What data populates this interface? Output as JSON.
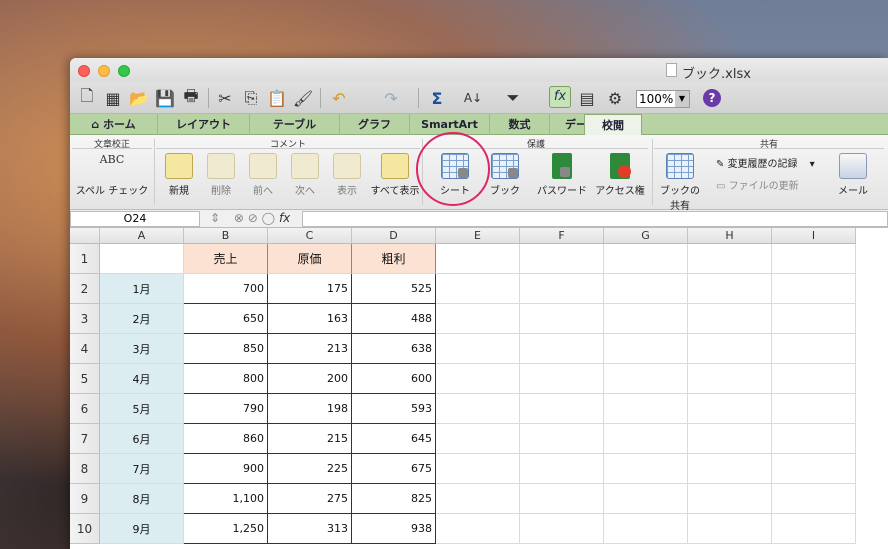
{
  "window": {
    "title": "ブック.xlsx"
  },
  "toolbar": {
    "zoom": "100%",
    "icons": [
      "new-icon",
      "gallery-icon",
      "open-icon",
      "save-icon",
      "print-icon",
      "cut-icon",
      "copy-icon",
      "paste-icon",
      "format-brush-icon",
      "undo-icon",
      "redo-icon",
      "autosum-icon",
      "sort-icon",
      "filter-icon",
      "formula-builder-icon",
      "show-formulas-icon",
      "toolbox-icon",
      "zoom-select",
      "help-icon"
    ]
  },
  "tabs": [
    {
      "label": "ホーム"
    },
    {
      "label": "レイアウト"
    },
    {
      "label": "テーブル"
    },
    {
      "label": "グラフ"
    },
    {
      "label": "SmartArt"
    },
    {
      "label": "数式"
    },
    {
      "label": "データ"
    },
    {
      "label": "校閲",
      "active": true
    }
  ],
  "ribbon": {
    "groups": {
      "proofing": "文章校正",
      "comments": "コメント",
      "protection": "保護",
      "share": "共有"
    },
    "buttons": {
      "spelling": "スペル チェック",
      "new_comment": "新規",
      "delete_comment": "削除",
      "previous": "前へ",
      "next": "次へ",
      "show": "表示",
      "show_all": "すべて表示",
      "sheet": "シート",
      "workbook": "ブック",
      "password": "パスワード",
      "access": "アクセス権",
      "share_workbook_1": "ブックの",
      "share_workbook_2": "共有",
      "track_changes": "変更履歴の記録",
      "update_file": "ファイルの更新",
      "mail": "メール",
      "abc": "ABC"
    }
  },
  "formula_bar": {
    "name_box": "O24",
    "fx": "fx"
  },
  "sheet": {
    "columns": [
      "A",
      "B",
      "C",
      "D",
      "E",
      "F",
      "G",
      "H",
      "I"
    ],
    "headers": [
      "売上",
      "原価",
      "粗利"
    ],
    "rows": [
      {
        "num": "1"
      },
      {
        "num": "2",
        "month": "1月",
        "sales": "700",
        "cost": "175",
        "profit": "525"
      },
      {
        "num": "3",
        "month": "2月",
        "sales": "650",
        "cost": "163",
        "profit": "488"
      },
      {
        "num": "4",
        "month": "3月",
        "sales": "850",
        "cost": "213",
        "profit": "638"
      },
      {
        "num": "5",
        "month": "4月",
        "sales": "800",
        "cost": "200",
        "profit": "600"
      },
      {
        "num": "6",
        "month": "5月",
        "sales": "790",
        "cost": "198",
        "profit": "593"
      },
      {
        "num": "7",
        "month": "6月",
        "sales": "860",
        "cost": "215",
        "profit": "645"
      },
      {
        "num": "8",
        "month": "7月",
        "sales": "900",
        "cost": "225",
        "profit": "675"
      },
      {
        "num": "9",
        "month": "8月",
        "sales": "1,100",
        "cost": "275",
        "profit": "825"
      },
      {
        "num": "10",
        "month": "9月",
        "sales": "1,250",
        "cost": "313",
        "profit": "938"
      }
    ]
  }
}
